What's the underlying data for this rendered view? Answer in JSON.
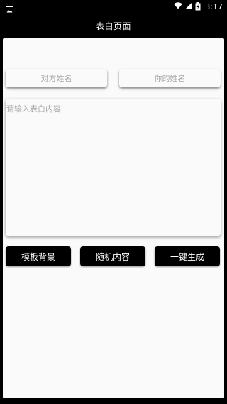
{
  "status_bar": {
    "time": "3:17",
    "icons": [
      "image-icon",
      "wifi-icon",
      "signal-icon",
      "battery-icon"
    ]
  },
  "app_bar": {
    "title": "表白页面"
  },
  "form": {
    "other_name_placeholder": "对方姓名",
    "your_name_placeholder": "你的姓名",
    "content_placeholder": "请输入表白内容"
  },
  "buttons": {
    "template_bg": "模板背景",
    "random_content": "随机内容",
    "one_click_generate": "一键生成"
  },
  "colors": {
    "primary": "#000000",
    "background": "#fafafa",
    "placeholder": "#a8a8a8"
  }
}
